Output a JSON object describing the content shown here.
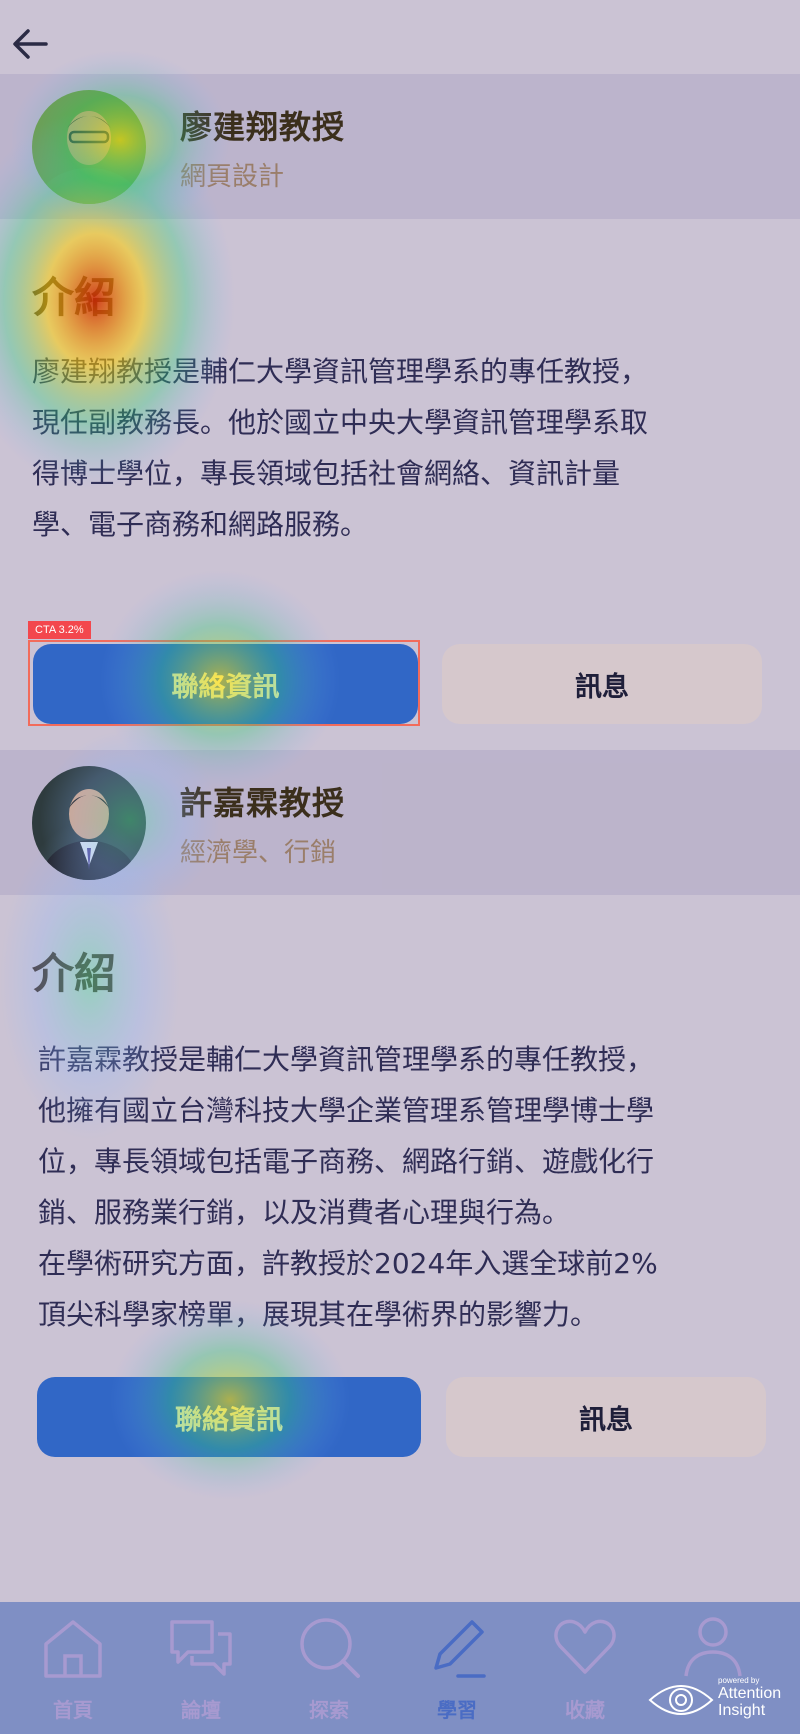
{
  "professors": [
    {
      "name": "廖建翔教授",
      "field": "網頁設計",
      "intro_title": "介紹",
      "intro_text": "廖建翔教授是輔仁大學資訊管理學系的專任教授，\n現任副教務長。他於國立中央大學資訊管理學系取\n得博士學位，專長領域包括社會網絡、資訊計量\n學、電子商務和網路服務。",
      "contact_label": "聯絡資訊",
      "message_label": "訊息"
    },
    {
      "name": "許嘉霖教授",
      "field": "經濟學、行銷",
      "intro_title": "介紹",
      "intro_text": "許嘉霖教授是輔仁大學資訊管理學系的專任教授，\n他擁有國立台灣科技大學企業管理系管理學博士學\n位，專長領域包括電子商務、網路行銷、遊戲化行\n銷、服務業行銷，以及消費者心理與行為。\n在學術研究方面，許教授於2024年入選全球前2%\n頂尖科學家榜單，展現其在學術界的影響力。",
      "contact_label": "聯絡資訊",
      "message_label": "訊息"
    }
  ],
  "cta_tag": "CTA 3.2%",
  "nav": {
    "items": [
      {
        "label": "首頁",
        "icon": "home-icon"
      },
      {
        "label": "論壇",
        "icon": "forum-icon"
      },
      {
        "label": "探索",
        "icon": "search-icon"
      },
      {
        "label": "學習",
        "icon": "pen-icon"
      },
      {
        "label": "收藏",
        "icon": "heart-icon"
      },
      {
        "label": "",
        "icon": "profile-icon"
      }
    ],
    "active_index": 3
  },
  "brand": {
    "powered_by": "powered by",
    "name_line1": "Attention",
    "name_line2": "Insight"
  },
  "colors": {
    "primary_button": "#3167c6",
    "secondary_button": "#d6c8cc",
    "nav_bg": "#7f8fc4",
    "cta_tag": "#f3474d"
  }
}
